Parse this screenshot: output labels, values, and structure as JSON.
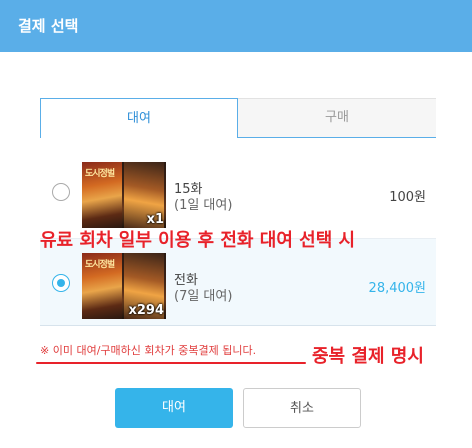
{
  "dialog": {
    "title": "결제 선택"
  },
  "tabs": [
    {
      "label": "대여",
      "active": true
    },
    {
      "label": "구매",
      "active": false
    }
  ],
  "items": [
    {
      "name": "15화",
      "sub": "(1일 대여)",
      "price": "100원",
      "thumb_count": "x1",
      "cover_title": "도시정벌",
      "selected": false
    },
    {
      "name": "전화",
      "sub": "(7일 대여)",
      "price": "28,400원",
      "thumb_count": "x294",
      "cover_title": "도시정벌",
      "selected": true
    }
  ],
  "annotations": {
    "selection_note": "유료 회차 일부 이용 후 전화 대여 선택 시",
    "duplicate_note": "중복 결제 명시"
  },
  "notice": "※ 이미 대여/구매하신 회차가 중복결제 됩니다.",
  "buttons": {
    "confirm": "대여",
    "cancel": "취소"
  },
  "colors": {
    "header": "#5aaee8",
    "accent": "#35b4ea",
    "annotation_red": "#e8222a"
  }
}
